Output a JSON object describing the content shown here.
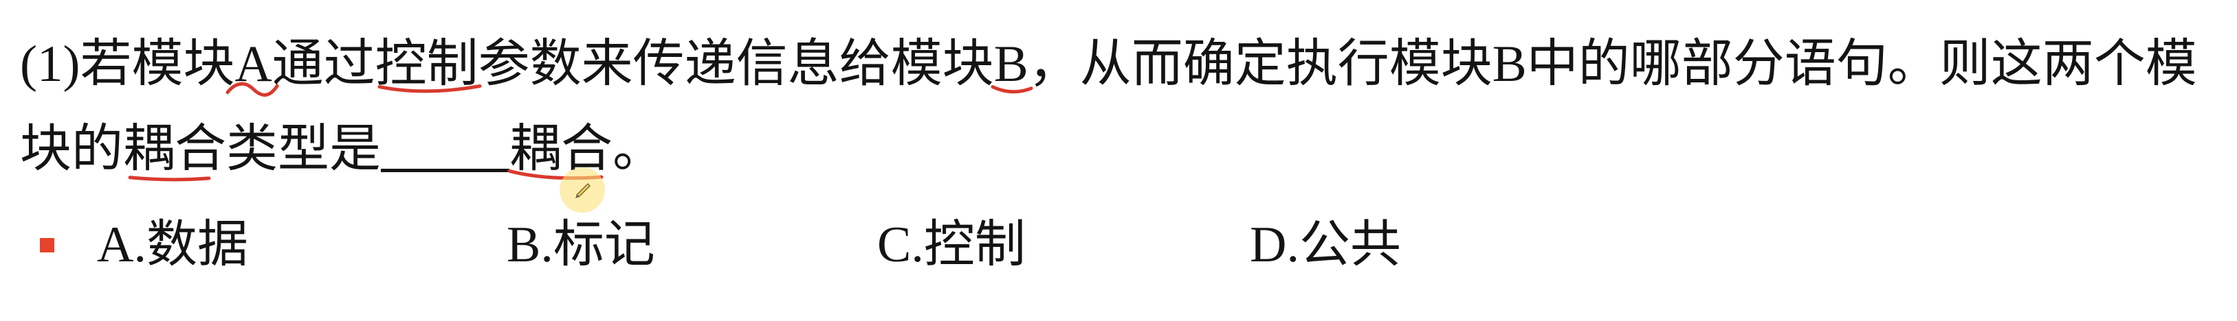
{
  "annotation_color": "#d93a2e",
  "cursor_highlight_color": "#fbe27a",
  "bullet_color": "#e5432c",
  "question": {
    "number": "(1)",
    "line1": {
      "t1": "若模块",
      "m1": "A",
      "t2": "通过",
      "m2": "控制",
      "t3": "参数来传递信息给模块",
      "m3": "B",
      "t4": "，从而确定执行模块B中的哪部分语句。则这两个模"
    },
    "line2": {
      "t1": "块的",
      "m1": "耦合",
      "t2": "类型是",
      "m2": "耦合",
      "t3": "。"
    }
  },
  "options": [
    {
      "label": "A.数据"
    },
    {
      "label": "B.标记"
    },
    {
      "label": "C.控制"
    },
    {
      "label": "D.公共"
    }
  ],
  "icons": {
    "bullet": "square-bullet-icon",
    "cursor": "pen-cursor-icon"
  }
}
